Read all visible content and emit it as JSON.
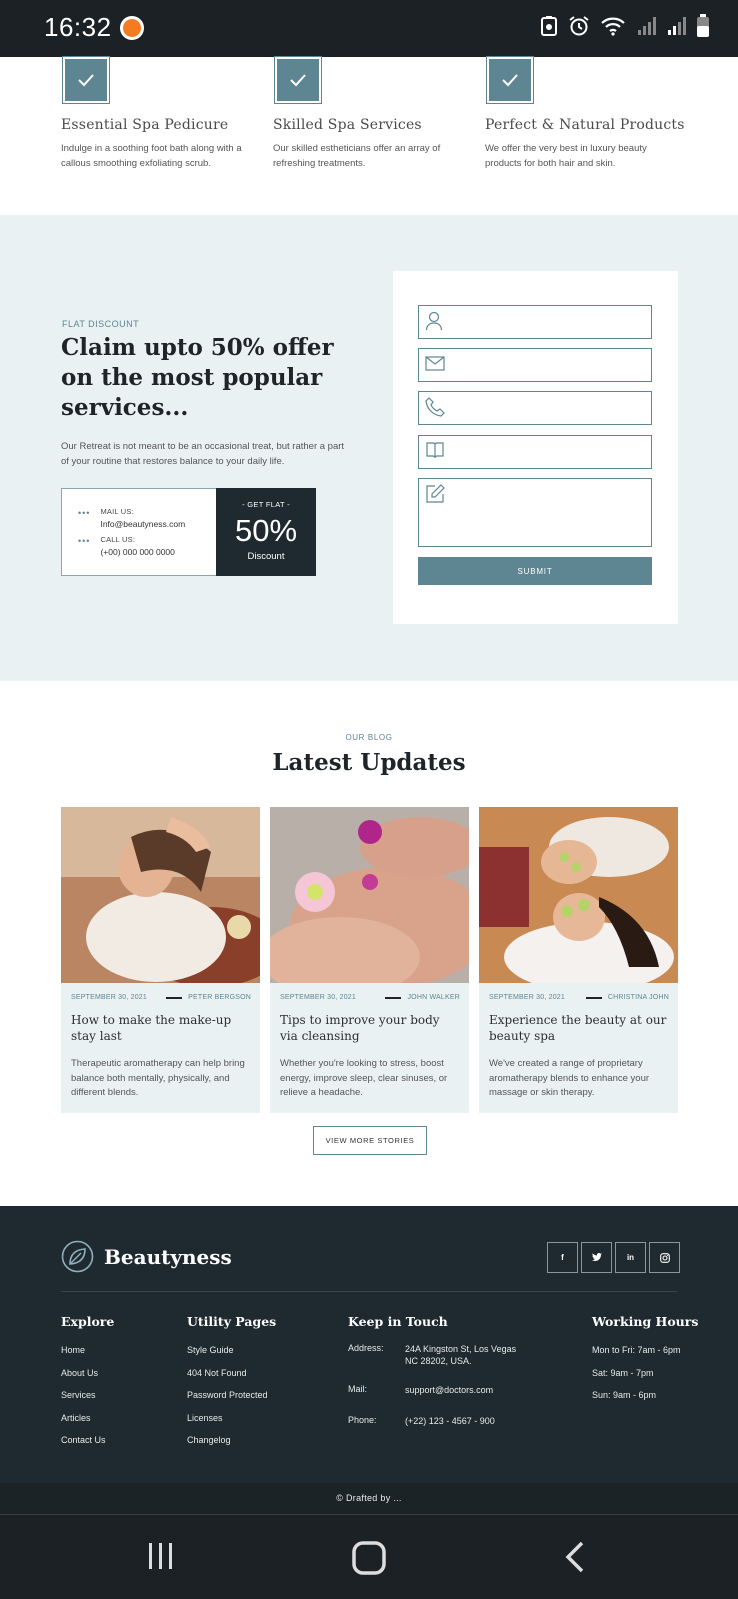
{
  "status_bar": {
    "time": "16:32"
  },
  "features": [
    {
      "title": "Essential Spa Pedicure",
      "desc": "Indulge in a soothing foot bath along with a callous smoothing exfoliating scrub."
    },
    {
      "title": "Skilled Spa Services",
      "desc": "Our skilled estheticians offer an array of refreshing treatments."
    },
    {
      "title": "Perfect & Natural Products",
      "desc": "We offer the very best in luxury beauty products for both hair and skin."
    }
  ],
  "offer": {
    "eyebrow": "FLAT DISCOUNT",
    "headline": "Claim upto 50% offer on the most popular services...",
    "paragraph": "Our Retreat is not meant to be an occasional treat, but rather a part of your routine that restores balance to your daily life.",
    "mail_label": "MAIL US:",
    "mail_value": "Info@beautyness.com",
    "call_label": "CALL US:",
    "call_value": "(+00) 000 000 0000",
    "get_flat": "- GET FLAT -",
    "percent": "50%",
    "discount": "Discount",
    "submit_label": "SUBMIT"
  },
  "blog": {
    "eyebrow": "OUR BLOG",
    "title": "Latest Updates",
    "posts": [
      {
        "date": "SEPTEMBER 30, 2021",
        "author": "PETER BERGSON",
        "title": "How to make the make-up stay last",
        "desc": "Therapeutic aromatherapy can help bring balance both mentally, physically, and different blends."
      },
      {
        "date": "SEPTEMBER 30, 2021",
        "author": "JOHN WALKER",
        "title": "Tips to improve your body via cleansing",
        "desc": "Whether you're looking to stress, boost energy, improve sleep, clear sinuses, or relieve a headache."
      },
      {
        "date": "SEPTEMBER 30, 2021",
        "author": "CHRISTINA JOHN",
        "title": "Experience the beauty at our beauty spa",
        "desc": "We've created a range of proprietary aromatherapy blends to enhance your massage or skin therapy."
      }
    ],
    "more_label": "VIEW MORE STORIES"
  },
  "footer": {
    "brand": "Beautyness",
    "social": [
      "f",
      "t",
      "in",
      "ig"
    ],
    "explore": {
      "heading": "Explore",
      "links": [
        "Home",
        "About Us",
        "Services",
        "Articles",
        "Contact Us"
      ]
    },
    "utility": {
      "heading": "Utility Pages",
      "links": [
        "Style Guide",
        "404 Not Found",
        "Password Protected",
        "Licenses",
        "Changelog"
      ]
    },
    "keep": {
      "heading": "Keep in Touch",
      "address_label": "Address:",
      "address_value": "24A Kingston St, Los Vegas NC 28202, USA.",
      "mail_label": "Mail:",
      "mail_value": "support@doctors.com",
      "phone_label": "Phone:",
      "phone_value": "(+22) 123 - 4567 - 900"
    },
    "hours": {
      "heading": "Working Hours",
      "lines": [
        "Mon to Fri: 7am - 6pm",
        "Sat: 9am - 7pm",
        "Sun: 9am - 6pm"
      ]
    },
    "copyright": "© Drafted by ..."
  }
}
